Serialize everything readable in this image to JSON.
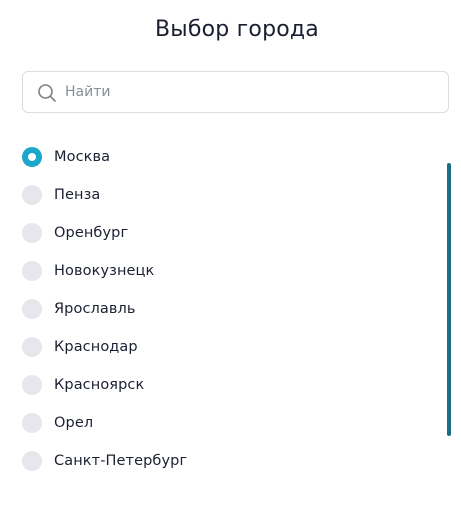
{
  "title": "Выбор города",
  "search": {
    "placeholder": "Найти",
    "value": ""
  },
  "cities": [
    {
      "label": "Москва",
      "selected": true
    },
    {
      "label": "Пенза",
      "selected": false
    },
    {
      "label": "Оренбург",
      "selected": false
    },
    {
      "label": "Новокузнецк",
      "selected": false
    },
    {
      "label": "Ярославль",
      "selected": false
    },
    {
      "label": "Краснодар",
      "selected": false
    },
    {
      "label": "Красноярск",
      "selected": false
    },
    {
      "label": "Орел",
      "selected": false
    },
    {
      "label": "Санкт-Петербург",
      "selected": false
    }
  ],
  "colors": {
    "accent": "#1aa7c9",
    "scrollbar": "#1a6d82",
    "radio_unselected": "#e6e7ec",
    "text": "#1c2033"
  },
  "icons": {
    "search": "search-icon"
  }
}
